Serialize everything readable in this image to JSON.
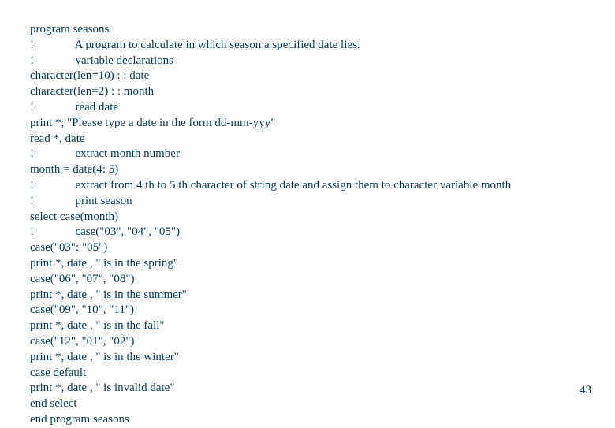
{
  "code": {
    "lines": [
      "program seasons",
      "!              A program to calculate in which season a specified date lies.",
      "!              variable declarations",
      "character(len=10) : : date",
      "character(len=2) : : month",
      "!              read date",
      "print *, \"Please type a date in the form dd-mm-yyy\"",
      "read *, date",
      "!              extract month number",
      "month = date(4: 5)",
      "!              extract from 4 th to 5 th character of string date and assign them to character variable month",
      "!              print season",
      "select case(month)",
      "!              case(\"03\", \"04\", \"05\")",
      "case(\"03\": \"05\")",
      "print *, date , \" is in the spring\"",
      "case(\"06\", \"07\", \"08\")",
      "print *, date , \" is in the summer\"",
      "case(\"09\", \"10\", \"11\")",
      "print *, date , \" is in the fall\"",
      "case(\"12\", \"01\", \"02\")",
      "print *, date , \" is in the winter\"",
      "case default",
      "print *, date , \" is invalid date\"",
      "end select",
      "end program seasons"
    ]
  },
  "page_number": "43"
}
